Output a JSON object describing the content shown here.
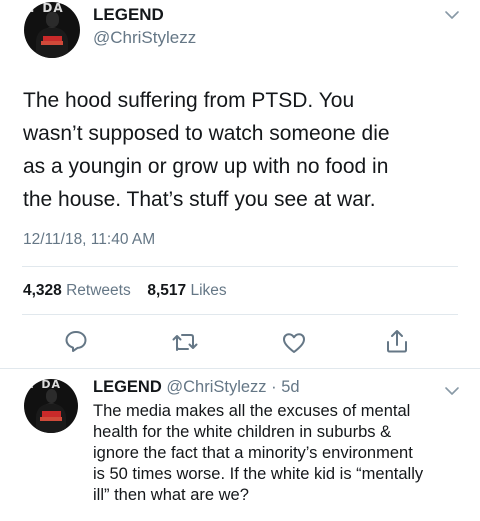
{
  "main_tweet": {
    "author_name": "LEGEND",
    "author_handle": "@ChriStylezz",
    "avatar_logo_text": "T DA",
    "text_lines": [
      "The hood suffering from PTSD. You",
      "wasn’t supposed to watch someone die",
      "as a youngin or grow up with no food in",
      "the house. That’s stuff you see at war."
    ],
    "timestamp": "12/11/18, 11:40 AM",
    "retweets_count": "4,328",
    "retweets_label": "Retweets",
    "likes_count": "8,517",
    "likes_label": "Likes"
  },
  "actions": {
    "reply_icon": "speech-bubble-icon",
    "retweet_icon": "retweet-icon",
    "like_icon": "heart-icon",
    "share_icon": "share-icon"
  },
  "reply_tweet": {
    "author_name": "LEGEND",
    "author_handle": "@ChriStylezz",
    "separator": " · ",
    "age": "5d",
    "avatar_logo_text": "T DA",
    "text_lines": [
      "The media makes all the excuses of mental",
      "health for the white children in suburbs &",
      "ignore the fact that a minority’s environment",
      "is 50 times worse. If the white kid is “mentally",
      "ill” then what are we?"
    ]
  },
  "colors": {
    "text": "#14171a",
    "muted": "#657786",
    "divider": "#e1e8ed",
    "icon": "#657786"
  }
}
